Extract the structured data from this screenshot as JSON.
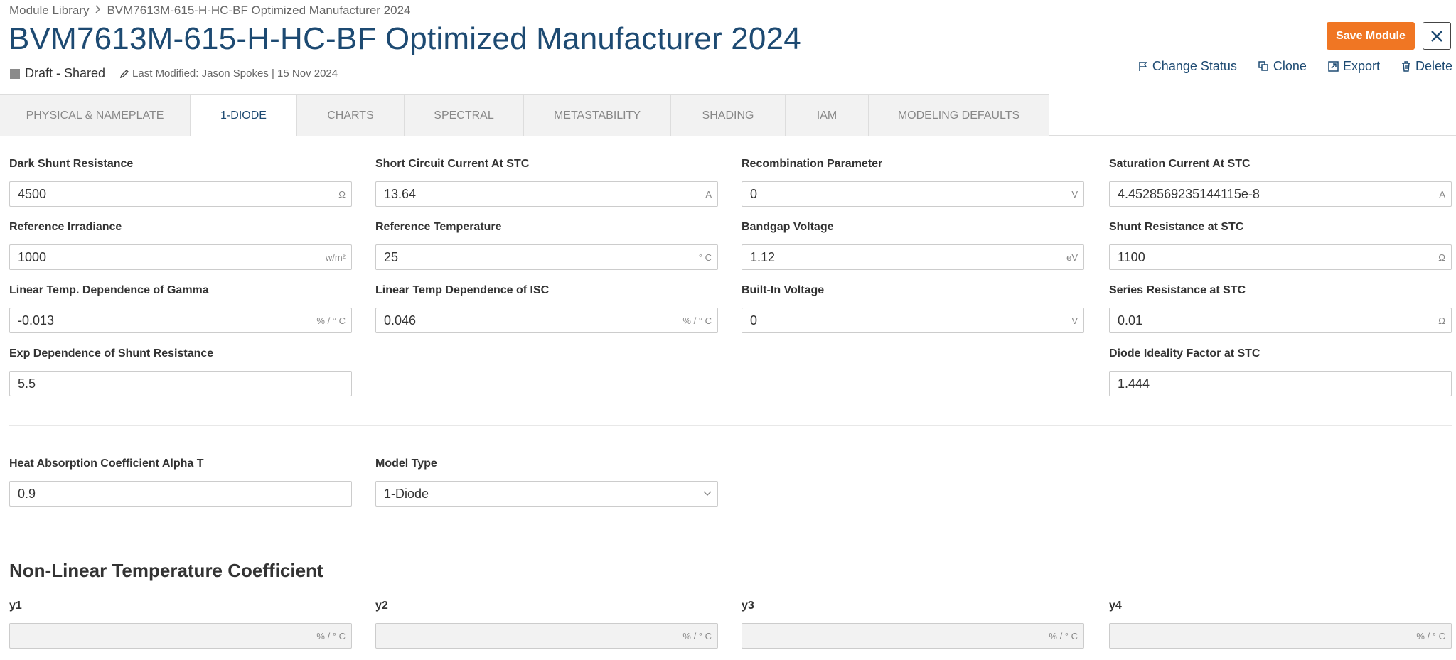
{
  "breadcrumb": {
    "root": "Module Library",
    "current": "BVM7613M-615-H-HC-BF Optimized Manufacturer 2024"
  },
  "title": "BVM7613M-615-H-HC-BF Optimized Manufacturer 2024",
  "status": {
    "label": "Draft - Shared",
    "modified": "Last Modified: Jason Spokes | 15 Nov 2024",
    "color": "#8a8a8a"
  },
  "header": {
    "save_label": "Save Module"
  },
  "actions": {
    "change_status": "Change Status",
    "clone": "Clone",
    "export": "Export",
    "delete": "Delete"
  },
  "tabs": [
    "PHYSICAL & NAMEPLATE",
    "1-DIODE",
    "CHARTS",
    "SPECTRAL",
    "METASTABILITY",
    "SHADING",
    "IAM",
    "MODELING DEFAULTS"
  ],
  "active_tab": "1-DIODE",
  "fields": {
    "dark_shunt": {
      "label": "Dark Shunt Resistance",
      "value": "4500",
      "unit": "Ω"
    },
    "isc_stc": {
      "label": "Short Circuit Current At STC",
      "value": "13.64",
      "unit": "A"
    },
    "recomb": {
      "label": "Recombination Parameter",
      "value": "0",
      "unit": "V"
    },
    "sat_current": {
      "label": "Saturation Current At STC",
      "value": "4.4528569235144115e-8",
      "unit": "A"
    },
    "ref_irr": {
      "label": "Reference Irradiance",
      "value": "1000",
      "unit": "w/m²"
    },
    "ref_temp": {
      "label": "Reference Temperature",
      "value": "25",
      "unit": "° C"
    },
    "bandgap": {
      "label": "Bandgap Voltage",
      "value": "1.12",
      "unit": "eV"
    },
    "shunt_stc": {
      "label": "Shunt Resistance at STC",
      "value": "1100",
      "unit": "Ω"
    },
    "gamma_temp": {
      "label": "Linear Temp. Dependence of Gamma",
      "value": "-0.013",
      "unit": "% / ° C"
    },
    "isc_temp": {
      "label": "Linear Temp Dependence of ISC",
      "value": "0.046",
      "unit": "% / ° C"
    },
    "builtin_v": {
      "label": "Built-In Voltage",
      "value": "0",
      "unit": "V"
    },
    "series_stc": {
      "label": "Series Resistance at STC",
      "value": "0.01",
      "unit": "Ω"
    },
    "exp_shunt": {
      "label": "Exp Dependence of Shunt Resistance",
      "value": "5.5",
      "unit": ""
    },
    "ideality": {
      "label": "Diode Ideality Factor at STC",
      "value": "1.444",
      "unit": ""
    },
    "alpha_t": {
      "label": "Heat Absorption Coefficient Alpha T",
      "value": "0.9",
      "unit": ""
    },
    "model_type": {
      "label": "Model Type",
      "value": "1-Diode"
    }
  },
  "nonlinear": {
    "title": "Non-Linear Temperature Coefficient",
    "y1": {
      "label": "y1",
      "value": "",
      "unit": "% / ° C"
    },
    "y2": {
      "label": "y2",
      "value": "",
      "unit": "% / ° C"
    },
    "y3": {
      "label": "y3",
      "value": "",
      "unit": "% / ° C"
    },
    "y4": {
      "label": "y4",
      "value": "",
      "unit": "% / ° C"
    }
  }
}
